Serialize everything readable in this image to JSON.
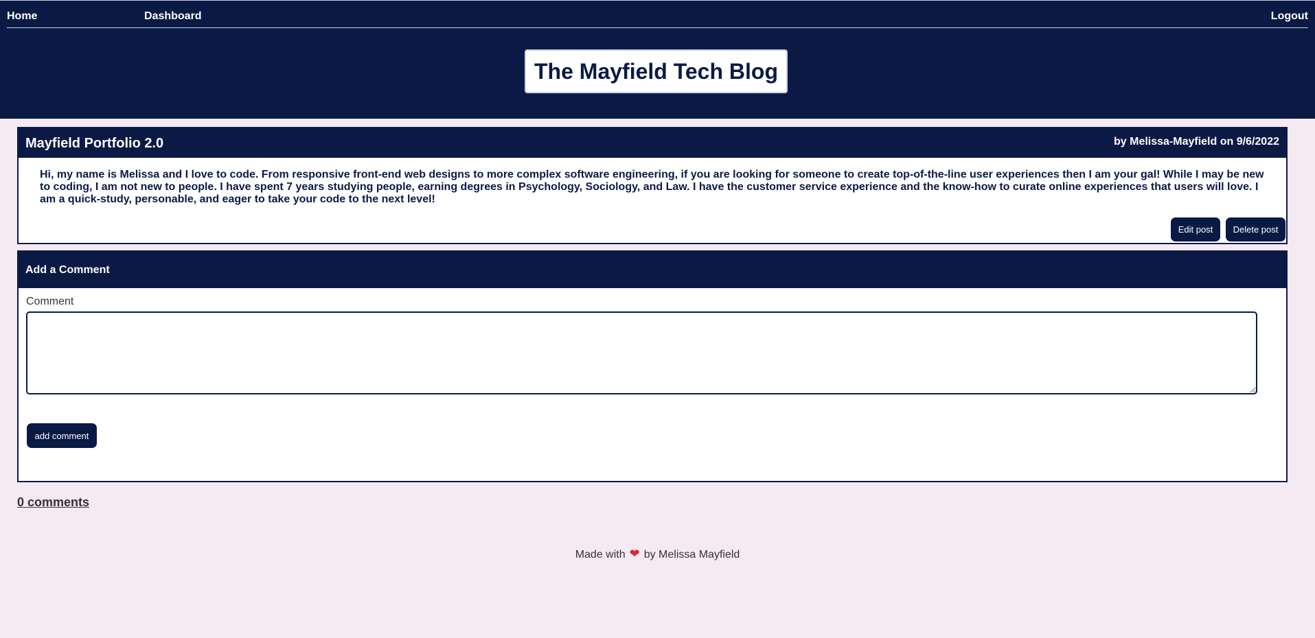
{
  "nav": {
    "home": "Home",
    "dashboard": "Dashboard",
    "logout": "Logout"
  },
  "site_title": "The Mayfield Tech Blog",
  "post": {
    "title": "Mayfield Portfolio 2.0",
    "meta": "by Melissa-Mayfield on 9/6/2022",
    "body": "Hi, my name is Melissa and I love to code. From responsive front-end web designs to more complex software engineering, if you are looking for someone to create top-of-the-line user experiences then I am your gal! While I may be new to coding, I am not new to people. I have spent 7 years studying people, earning degrees in Psychology, Sociology, and Law. I have the customer service experience and the know-how to curate online experiences that users will love. I am a quick-study, personable, and eager to take your code to the next level!",
    "edit_label": "Edit post",
    "delete_label": "Delete post"
  },
  "comment_form": {
    "header": "Add a Comment",
    "label": "Comment",
    "value": "",
    "submit_label": "add comment"
  },
  "comments_count": "0 comments",
  "footer": {
    "prefix": "Made with",
    "icon": "heart-icon",
    "suffix": "by Melissa Mayfield"
  },
  "colors": {
    "primary": "#0a1a45",
    "background": "#f5e9f2",
    "heart": "#e0262c"
  }
}
